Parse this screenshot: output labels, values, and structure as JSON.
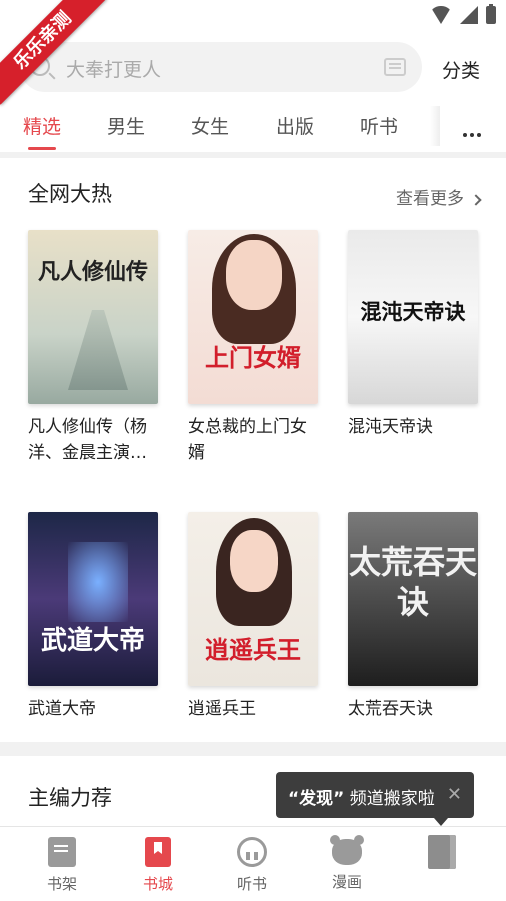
{
  "ribbon": {
    "text": "乐乐亲测"
  },
  "search": {
    "placeholder": "大奉打更人",
    "category_label": "分类"
  },
  "tabs": [
    {
      "label": "精选",
      "active": true
    },
    {
      "label": "男生"
    },
    {
      "label": "女生"
    },
    {
      "label": "出版"
    },
    {
      "label": "听书"
    }
  ],
  "hot_section": {
    "title": "全网大热",
    "more_label": "查看更多",
    "books": [
      {
        "title": "凡人修仙传（杨洋、金晨主演…",
        "cover_text": "凡人修仙传"
      },
      {
        "title": "女总裁的上门女婿",
        "cover_text": "上门女婿"
      },
      {
        "title": "混沌天帝诀",
        "cover_text": "混沌天帝诀"
      },
      {
        "title": "武道大帝",
        "cover_text": "武道大帝"
      },
      {
        "title": "逍遥兵王",
        "cover_text": "逍遥兵王"
      },
      {
        "title": "太荒吞天诀",
        "cover_text": "太荒吞天诀"
      }
    ]
  },
  "editor_section": {
    "title": "主编力荐"
  },
  "toast": {
    "highlight": "“发现”",
    "text": " 频道搬家啦",
    "close": "✕"
  },
  "bottom_nav": [
    {
      "label": "书架",
      "icon": "bookshelf-icon"
    },
    {
      "label": "书城",
      "icon": "bookstore-icon",
      "active": true
    },
    {
      "label": "听书",
      "icon": "headphones-icon"
    },
    {
      "label": "漫画",
      "icon": "comic-bear-icon"
    },
    {
      "label": "",
      "icon": "discover-icon"
    }
  ],
  "colors": {
    "accent": "#e5484d",
    "toast_bg": "#3d3d3d"
  }
}
